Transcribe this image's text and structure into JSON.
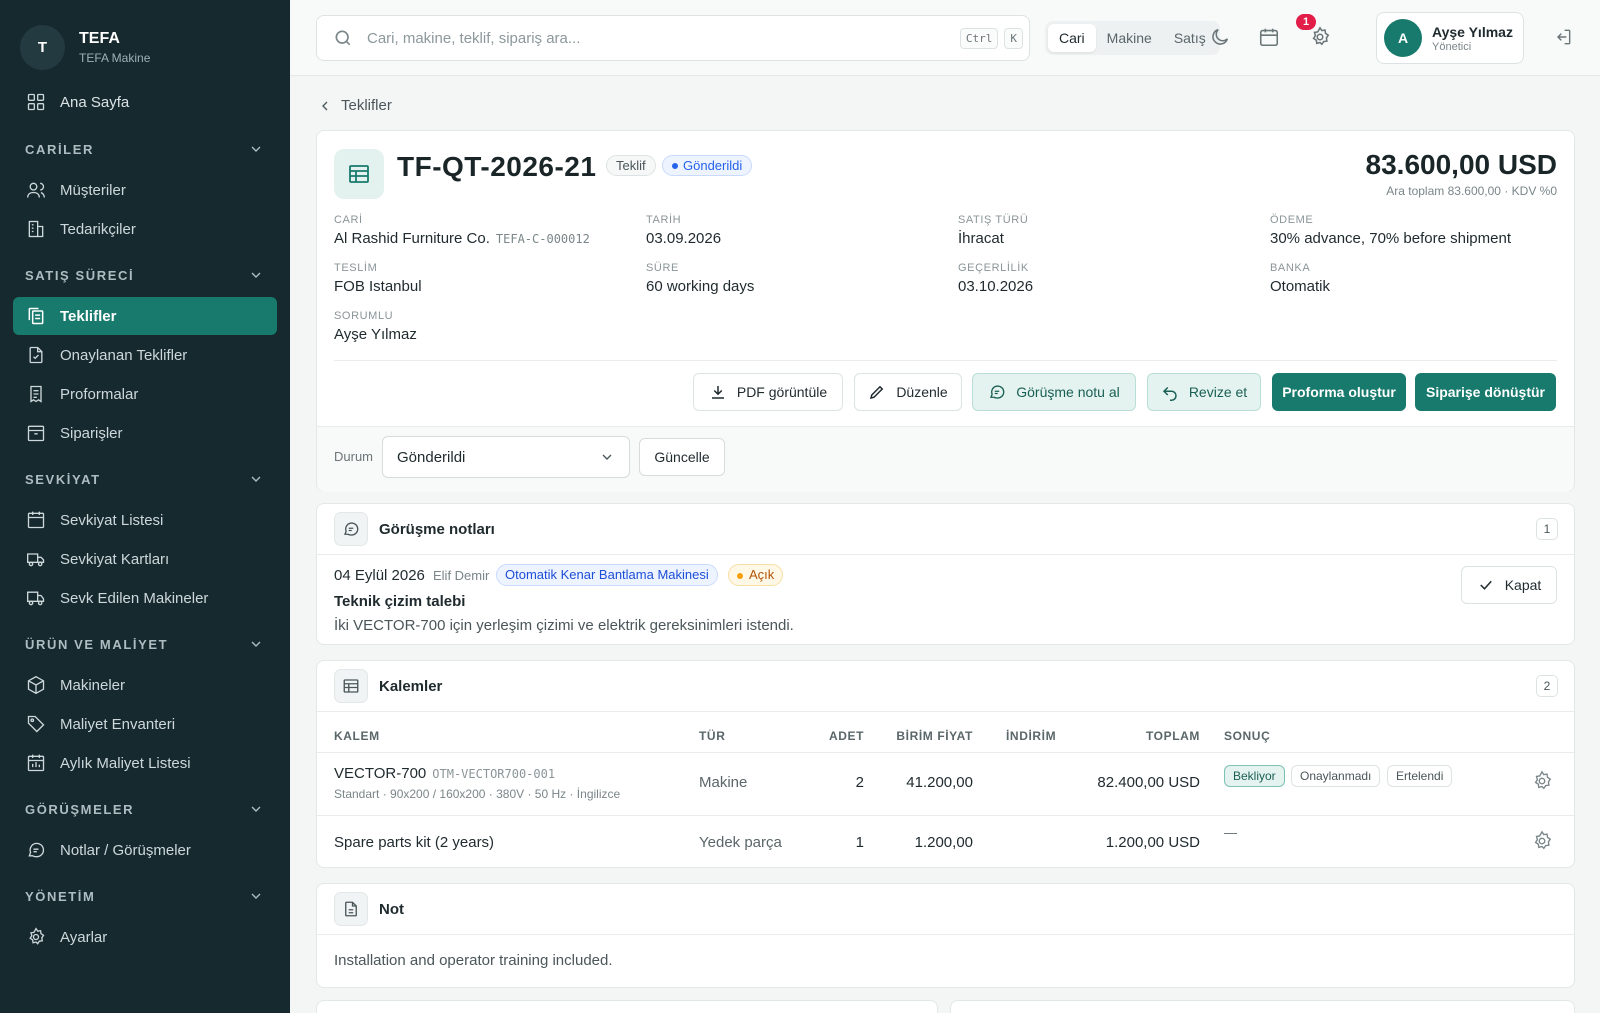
{
  "brand": {
    "initial": "T",
    "name": "TEFA",
    "subtitle": "TEFA Makine"
  },
  "nav": {
    "home": "Ana Sayfa",
    "sections": [
      {
        "title": "CARİLER",
        "items": [
          "Müşteriler",
          "Tedarikçiler"
        ]
      },
      {
        "title": "SATIŞ SÜRECİ",
        "items": [
          "Teklifler",
          "Onaylanan Teklifler",
          "Proformalar",
          "Siparişler"
        ]
      },
      {
        "title": "SEVKİYAT",
        "items": [
          "Sevkiyat Listesi",
          "Sevkiyat Kartları",
          "Sevk Edilen Makineler"
        ]
      },
      {
        "title": "ÜRÜN VE MALİYET",
        "items": [
          "Makineler",
          "Maliyet Envanteri",
          "Aylık Maliyet Listesi"
        ]
      },
      {
        "title": "GÖRÜŞMELER",
        "items": [
          "Notlar / Görüşmeler"
        ]
      },
      {
        "title": "YÖNETİM",
        "items": [
          "Ayarlar"
        ]
      }
    ],
    "active": "Teklifler"
  },
  "topbar": {
    "search_placeholder": "Cari, makine, teklif, sipariş ara...",
    "kbd_ctrl": "Ctrl",
    "kbd_k": "K",
    "segments": [
      "Cari",
      "Makine",
      "Satış"
    ],
    "active_segment": "Cari",
    "notification_count": "1",
    "user_initial": "A",
    "user_name": "Ayşe Yılmaz",
    "user_role": "Yönetici"
  },
  "breadcrumb": "Teklifler",
  "quote": {
    "number": "TF-QT-2026-21",
    "type_badge": "Teklif",
    "status_badge": "Gönderildi",
    "total": "83.600,00 USD",
    "total_sub": "Ara toplam 83.600,00 · KDV %0",
    "fields": {
      "cari_label": "CARİ",
      "cari_value": "Al Rashid Furniture Co.",
      "cari_code": "TEFA-C-000012",
      "tarih_label": "TARİH",
      "tarih_value": "03.09.2026",
      "satis_label": "SATIŞ TÜRÜ",
      "satis_value": "İhracat",
      "odeme_label": "ÖDEME",
      "odeme_value": "30% advance, 70% before shipment",
      "teslim_label": "TESLİM",
      "teslim_value": "FOB Istanbul",
      "sure_label": "SÜRE",
      "sure_value": "60 working days",
      "gecerlilik_label": "GEÇERLİLİK",
      "gecerlilik_value": "03.10.2026",
      "banka_label": "BANKA",
      "banka_value": "Otomatik",
      "sorumlu_label": "SORUMLU",
      "sorumlu_value": "Ayşe Yılmaz"
    },
    "actions": {
      "pdf": "PDF görüntüle",
      "edit": "Düzenle",
      "note": "Görüşme notu al",
      "revise": "Revize et",
      "proforma": "Proforma oluştur",
      "order": "Siparişe dönüştür"
    },
    "status_label": "Durum",
    "status_value": "Gönderildi",
    "update_button": "Güncelle"
  },
  "notes": {
    "title": "Görüşme notları",
    "count": "1",
    "item": {
      "date": "04 Eylül 2026",
      "author": "Elif Demir",
      "machine_tag": "Otomatik Kenar Bantlama Makinesi",
      "state_tag": "Açık",
      "title": "Teknik çizim talebi",
      "body": "İki VECTOR-700 için yerleşim çizimi ve elektrik gereksinimleri istendi.",
      "close_button": "Kapat"
    }
  },
  "items": {
    "title": "Kalemler",
    "count": "2",
    "columns": [
      "KALEM",
      "TÜR",
      "ADET",
      "BİRİM FİYAT",
      "İNDİRİM",
      "TOPLAM",
      "SONUÇ"
    ],
    "rows": [
      {
        "name": "VECTOR-700",
        "code": "OTM-VECTOR700-001",
        "sub": "Standart · 90x200 / 160x200 · 380V · 50 Hz · İngilizce",
        "type": "Makine",
        "qty": "2",
        "unit": "41.200,00",
        "discount": "",
        "total": "82.400,00 USD",
        "results": [
          "Bekliyor",
          "Onaylanmadı",
          "Ertelendi"
        ],
        "selected_result": "Bekliyor"
      },
      {
        "name": "Spare parts kit (2 years)",
        "code": "",
        "sub": "",
        "type": "Yedek parça",
        "qty": "1",
        "unit": "1.200,00",
        "discount": "",
        "total": "1.200,00 USD",
        "results_placeholder": "—"
      }
    ]
  },
  "note_section": {
    "title": "Not",
    "body": "Installation and operator training included."
  },
  "colors": {
    "sidebar": "#16292f",
    "accent": "#187a6d",
    "info": "#2563eb",
    "warning": "#f59e0b",
    "danger": "#e11d48"
  }
}
